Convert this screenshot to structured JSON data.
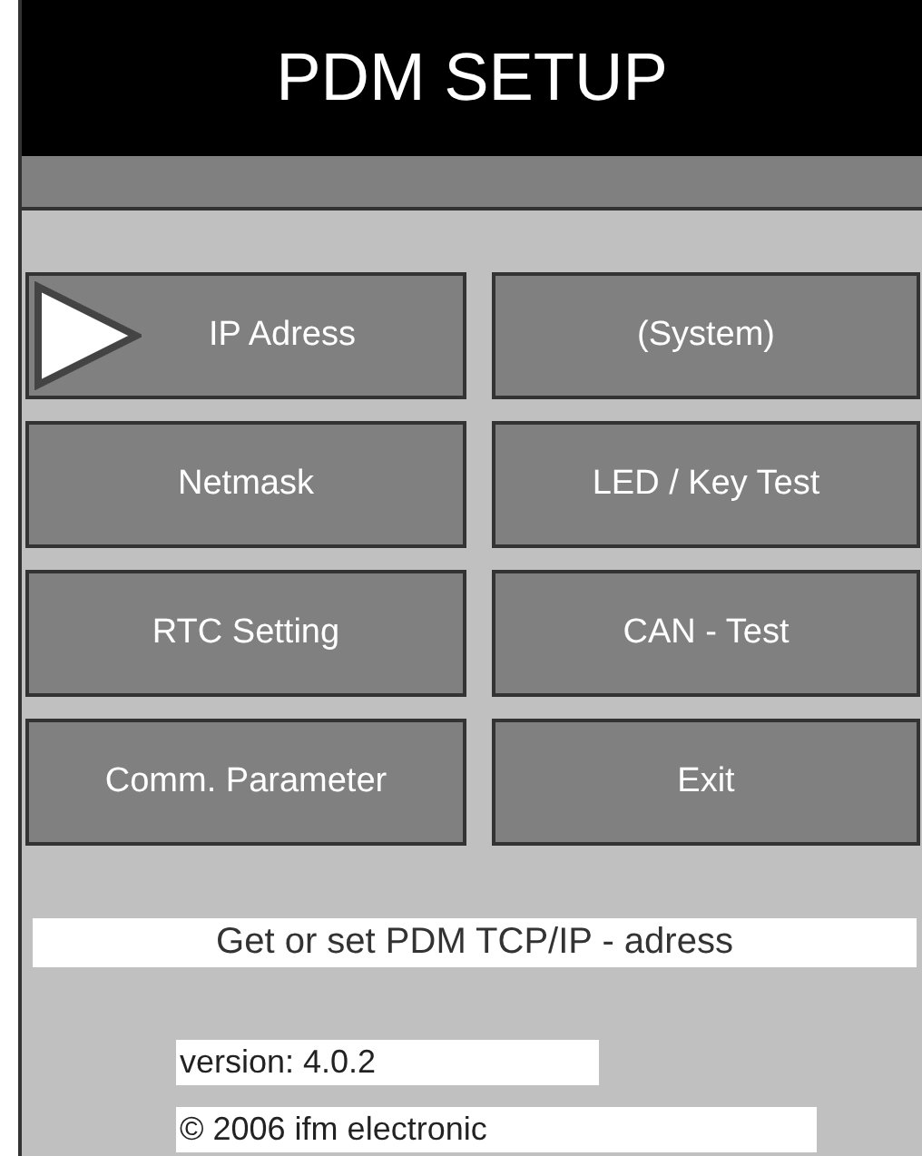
{
  "window": {
    "title": "PDM SETUP"
  },
  "buttons": [
    {
      "label": "IP Adress",
      "selected": true
    },
    {
      "label": "(System)",
      "selected": false
    },
    {
      "label": "Netmask",
      "selected": false
    },
    {
      "label": "LED / Key Test",
      "selected": false
    },
    {
      "label": "RTC Setting",
      "selected": false
    },
    {
      "label": "CAN - Test",
      "selected": false
    },
    {
      "label": "Comm. Parameter",
      "selected": false
    },
    {
      "label": "Exit",
      "selected": false
    }
  ],
  "description": "Get or set PDM TCP/IP - adress",
  "version": "version: 4.0.2",
  "copyright": "© 2006 ifm electronic"
}
